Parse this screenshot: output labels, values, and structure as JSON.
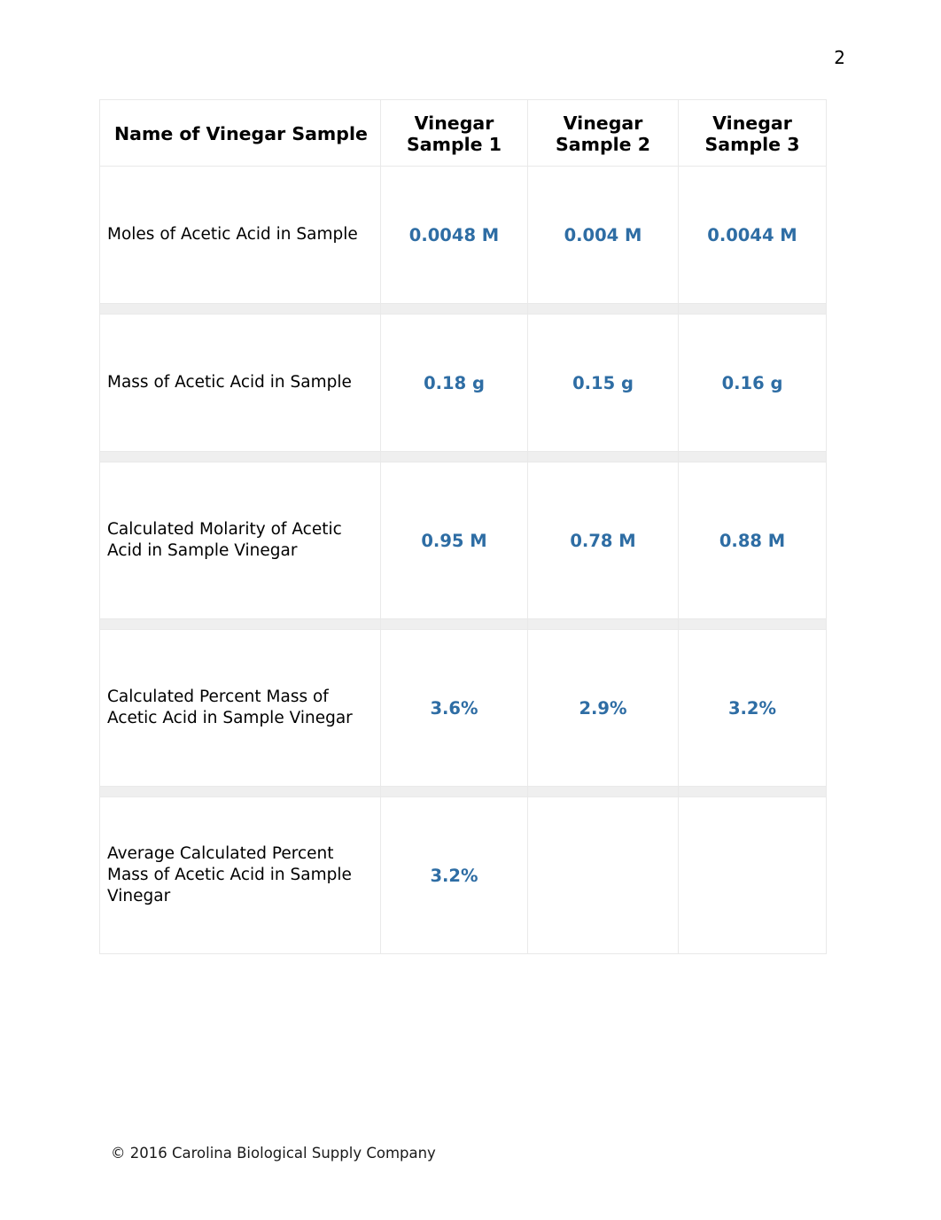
{
  "page": {
    "number": "2"
  },
  "table": {
    "headers": [
      "Name of Vinegar Sample",
      "Vinegar\nSample 1",
      "Vinegar\nSample 2",
      "Vinegar\nSample 3"
    ],
    "rows": [
      {
        "label": "Moles of Acetic Acid in Sample",
        "sample1": "0.0048 M",
        "sample2": "0.004 M",
        "sample3": "0.0044 M"
      },
      {
        "label": "Mass of Acetic Acid in Sample",
        "sample1": "0.18 g",
        "sample2": "0.15 g",
        "sample3": "0.16 g"
      },
      {
        "label": "Calculated Molarity of Acetic Acid in Sample Vinegar",
        "sample1": "0.95 M",
        "sample2": "0.78 M",
        "sample3": "0.88 M"
      },
      {
        "label": "Calculated Percent Mass of Acetic Acid in Sample Vinegar",
        "sample1": "3.6%",
        "sample2": "2.9%",
        "sample3": "3.2%"
      },
      {
        "label": "Average Calculated Percent Mass of Acetic Acid in Sample Vinegar",
        "sample1": "3.2%",
        "sample2": "",
        "sample3": ""
      }
    ]
  },
  "footer": {
    "copyright": "© 2016 Carolina Biological Supply Company"
  },
  "colors": {
    "value_blue": "#2e6da4",
    "border_gray": "#e9e9e9",
    "band_gray": "#efefef",
    "text_black": "#000000"
  }
}
